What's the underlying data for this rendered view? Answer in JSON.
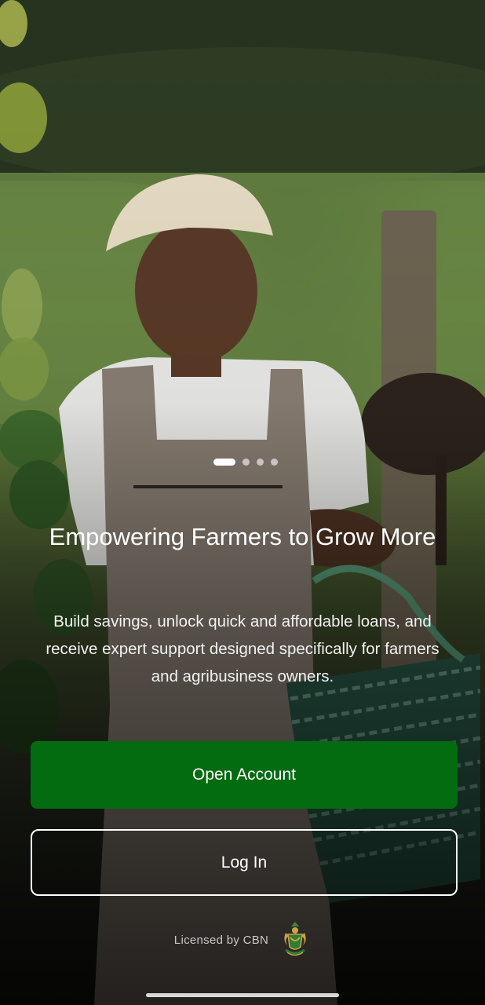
{
  "onboarding": {
    "pager": {
      "total": 4,
      "active_index": 0
    },
    "headline": "Empowering Farmers to Grow More",
    "subtext": "Build savings, unlock quick and affordable loans, and receive expert support designed specifically for farmers and agribusiness owners."
  },
  "actions": {
    "open_account_label": "Open Account",
    "login_label": "Log In"
  },
  "footer": {
    "license_text": "Licensed by CBN",
    "license_logo_icon": "cbn-seal-icon"
  },
  "colors": {
    "primary_green": "#046c10",
    "text_white": "#ffffff"
  }
}
